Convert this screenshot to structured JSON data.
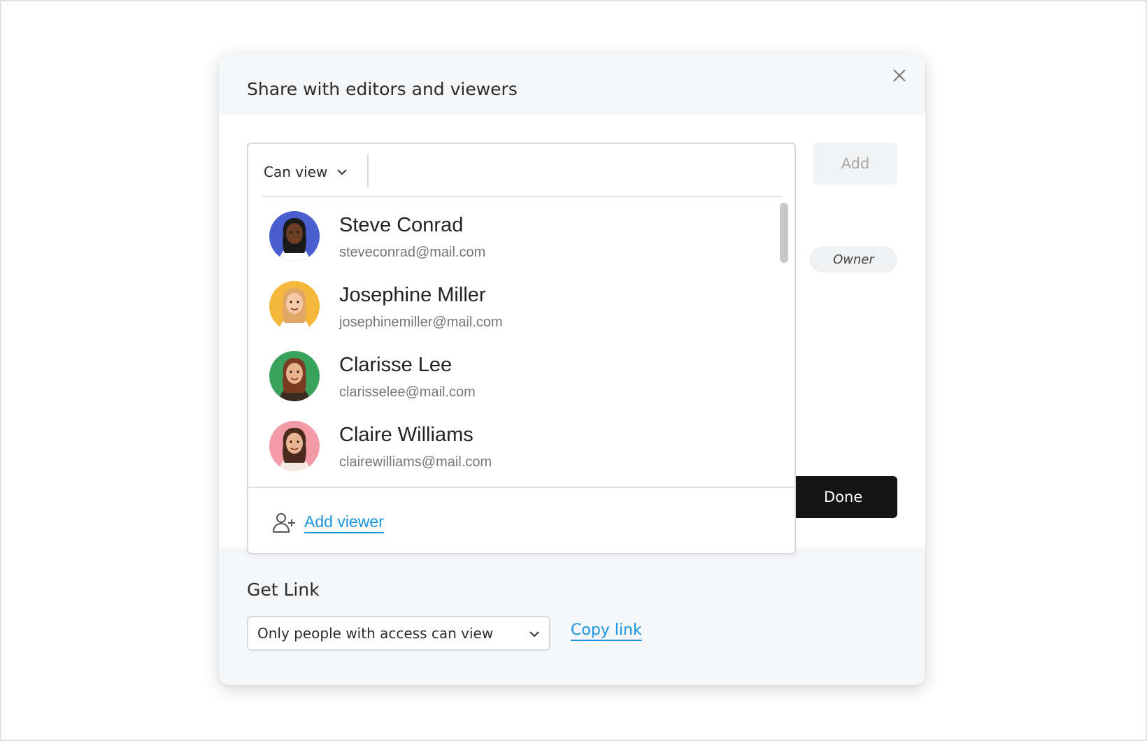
{
  "modal": {
    "title": "Share with editors and viewers",
    "add_label": "Add",
    "owner_label": "Owner",
    "done_label": "Done"
  },
  "invite": {
    "permission": "Can view",
    "email_placeholder": "",
    "add_viewer_label": "Add viewer",
    "contacts": [
      {
        "name": "Steve Conrad",
        "email": "steveconrad@mail.com",
        "avatar_bg": "#4a5fcf",
        "skin": "#6b3e26",
        "hair": "#1a1a1a",
        "shirt": "#ffffff"
      },
      {
        "name": "Josephine Miller",
        "email": "josephinemiller@mail.com",
        "avatar_bg": "#f5b83d",
        "skin": "#f3c9a8",
        "hair": "#e0a766",
        "shirt": "#ffffff"
      },
      {
        "name": "Clarisse Lee",
        "email": "clarisselee@mail.com",
        "avatar_bg": "#3aa35b",
        "skin": "#e9b58e",
        "hair": "#7a3b22",
        "shirt": "#3b2a20"
      },
      {
        "name": "Claire Williams",
        "email": "clairewilliams@mail.com",
        "avatar_bg": "#f29aa6",
        "skin": "#e8b592",
        "hair": "#4a2a1a",
        "shirt": "#f5e9e2"
      }
    ]
  },
  "get_link": {
    "title": "Get Link",
    "access": "Only people with access can view",
    "copy_label": "Copy link"
  },
  "colors": {
    "link_blue": "#1a93e0",
    "done_bg": "#141414"
  }
}
